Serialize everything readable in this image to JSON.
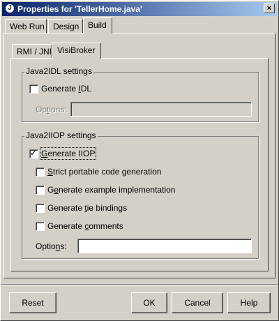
{
  "window": {
    "title": "Properties for 'TellerHome.java'",
    "app_icon_glyph": "J",
    "close_glyph": "×"
  },
  "tabs": [
    {
      "label": "Web Run",
      "selected": false
    },
    {
      "label": "Design",
      "selected": false
    },
    {
      "label": "Build",
      "selected": true
    }
  ],
  "subtabs": [
    {
      "label": "RMI / JNI",
      "selected": false
    },
    {
      "label": "VisiBroker",
      "selected": true
    }
  ],
  "java2idl": {
    "title": "Java2IDL settings",
    "generate_idl": {
      "label_pre": "Generate ",
      "label_key": "I",
      "label_post": "DL",
      "checked": false
    },
    "options": {
      "label_pre": "Op",
      "label_key": "t",
      "label_post": "ions:",
      "value": "",
      "enabled": false
    }
  },
  "java2iiop": {
    "title": "Java2IIOP settings",
    "generate_iiop": {
      "label_pre": "",
      "label_key": "G",
      "label_post": "enerate IIOP",
      "checked": true,
      "check_glyph": "✓"
    },
    "strict": {
      "label_pre": "",
      "label_key": "S",
      "label_post": "trict portable code generation",
      "checked": false
    },
    "example_impl": {
      "label_pre": "G",
      "label_key": "e",
      "label_post": "nerate example implementation",
      "checked": false
    },
    "tie_bindings": {
      "label_pre": "Generate ",
      "label_key": "t",
      "label_post": "ie bindings",
      "checked": false
    },
    "comments": {
      "label_pre": "Generate ",
      "label_key": "c",
      "label_post": "omments",
      "checked": false
    },
    "options": {
      "label_pre": "Optio",
      "label_key": "n",
      "label_post": "s:",
      "value": "",
      "enabled": true
    }
  },
  "buttons": {
    "reset": "Reset",
    "ok": "OK",
    "cancel": "Cancel",
    "help": "Help"
  },
  "colors": {
    "face": "#d4d0c8",
    "title_start": "#0a246a",
    "title_end": "#a6caf0",
    "disabled_text": "#808080"
  }
}
